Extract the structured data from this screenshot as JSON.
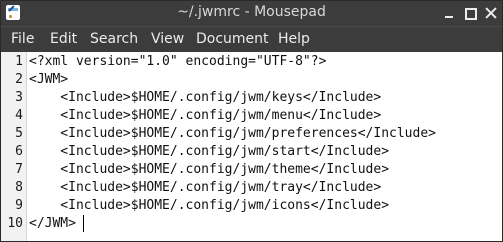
{
  "window": {
    "title": "~/.jwmrc - Mousepad",
    "icon": "mousepad-app-icon"
  },
  "titlebar_buttons": {
    "minimize": "minimize-icon",
    "maximize": "maximize-icon",
    "close": "close-icon"
  },
  "menu": {
    "file": "File",
    "edit": "Edit",
    "search": "Search",
    "view": "View",
    "document": "Document",
    "help": "Help"
  },
  "editor": {
    "lines": [
      {
        "num": "1",
        "text": "<?xml version=\"1.0\" encoding=\"UTF-8\"?>"
      },
      {
        "num": "2",
        "text": "<JWM>"
      },
      {
        "num": "3",
        "text": "    <Include>$HOME/.config/jwm/keys</Include>"
      },
      {
        "num": "4",
        "text": "    <Include>$HOME/.config/jwm/menu</Include>"
      },
      {
        "num": "5",
        "text": "    <Include>$HOME/.config/jwm/preferences</Include>"
      },
      {
        "num": "6",
        "text": "    <Include>$HOME/.config/jwm/start</Include>"
      },
      {
        "num": "7",
        "text": "    <Include>$HOME/.config/jwm/theme</Include>"
      },
      {
        "num": "8",
        "text": "    <Include>$HOME/.config/jwm/tray</Include>"
      },
      {
        "num": "9",
        "text": "    <Include>$HOME/.config/jwm/icons</Include>"
      },
      {
        "num": "10",
        "text": "</JWM>"
      }
    ]
  },
  "colors": {
    "chrome": "#3c3c3c",
    "chrome_text": "#ececec",
    "editor_bg": "#ffffff",
    "gutter_bg": "#f2f2f2"
  }
}
